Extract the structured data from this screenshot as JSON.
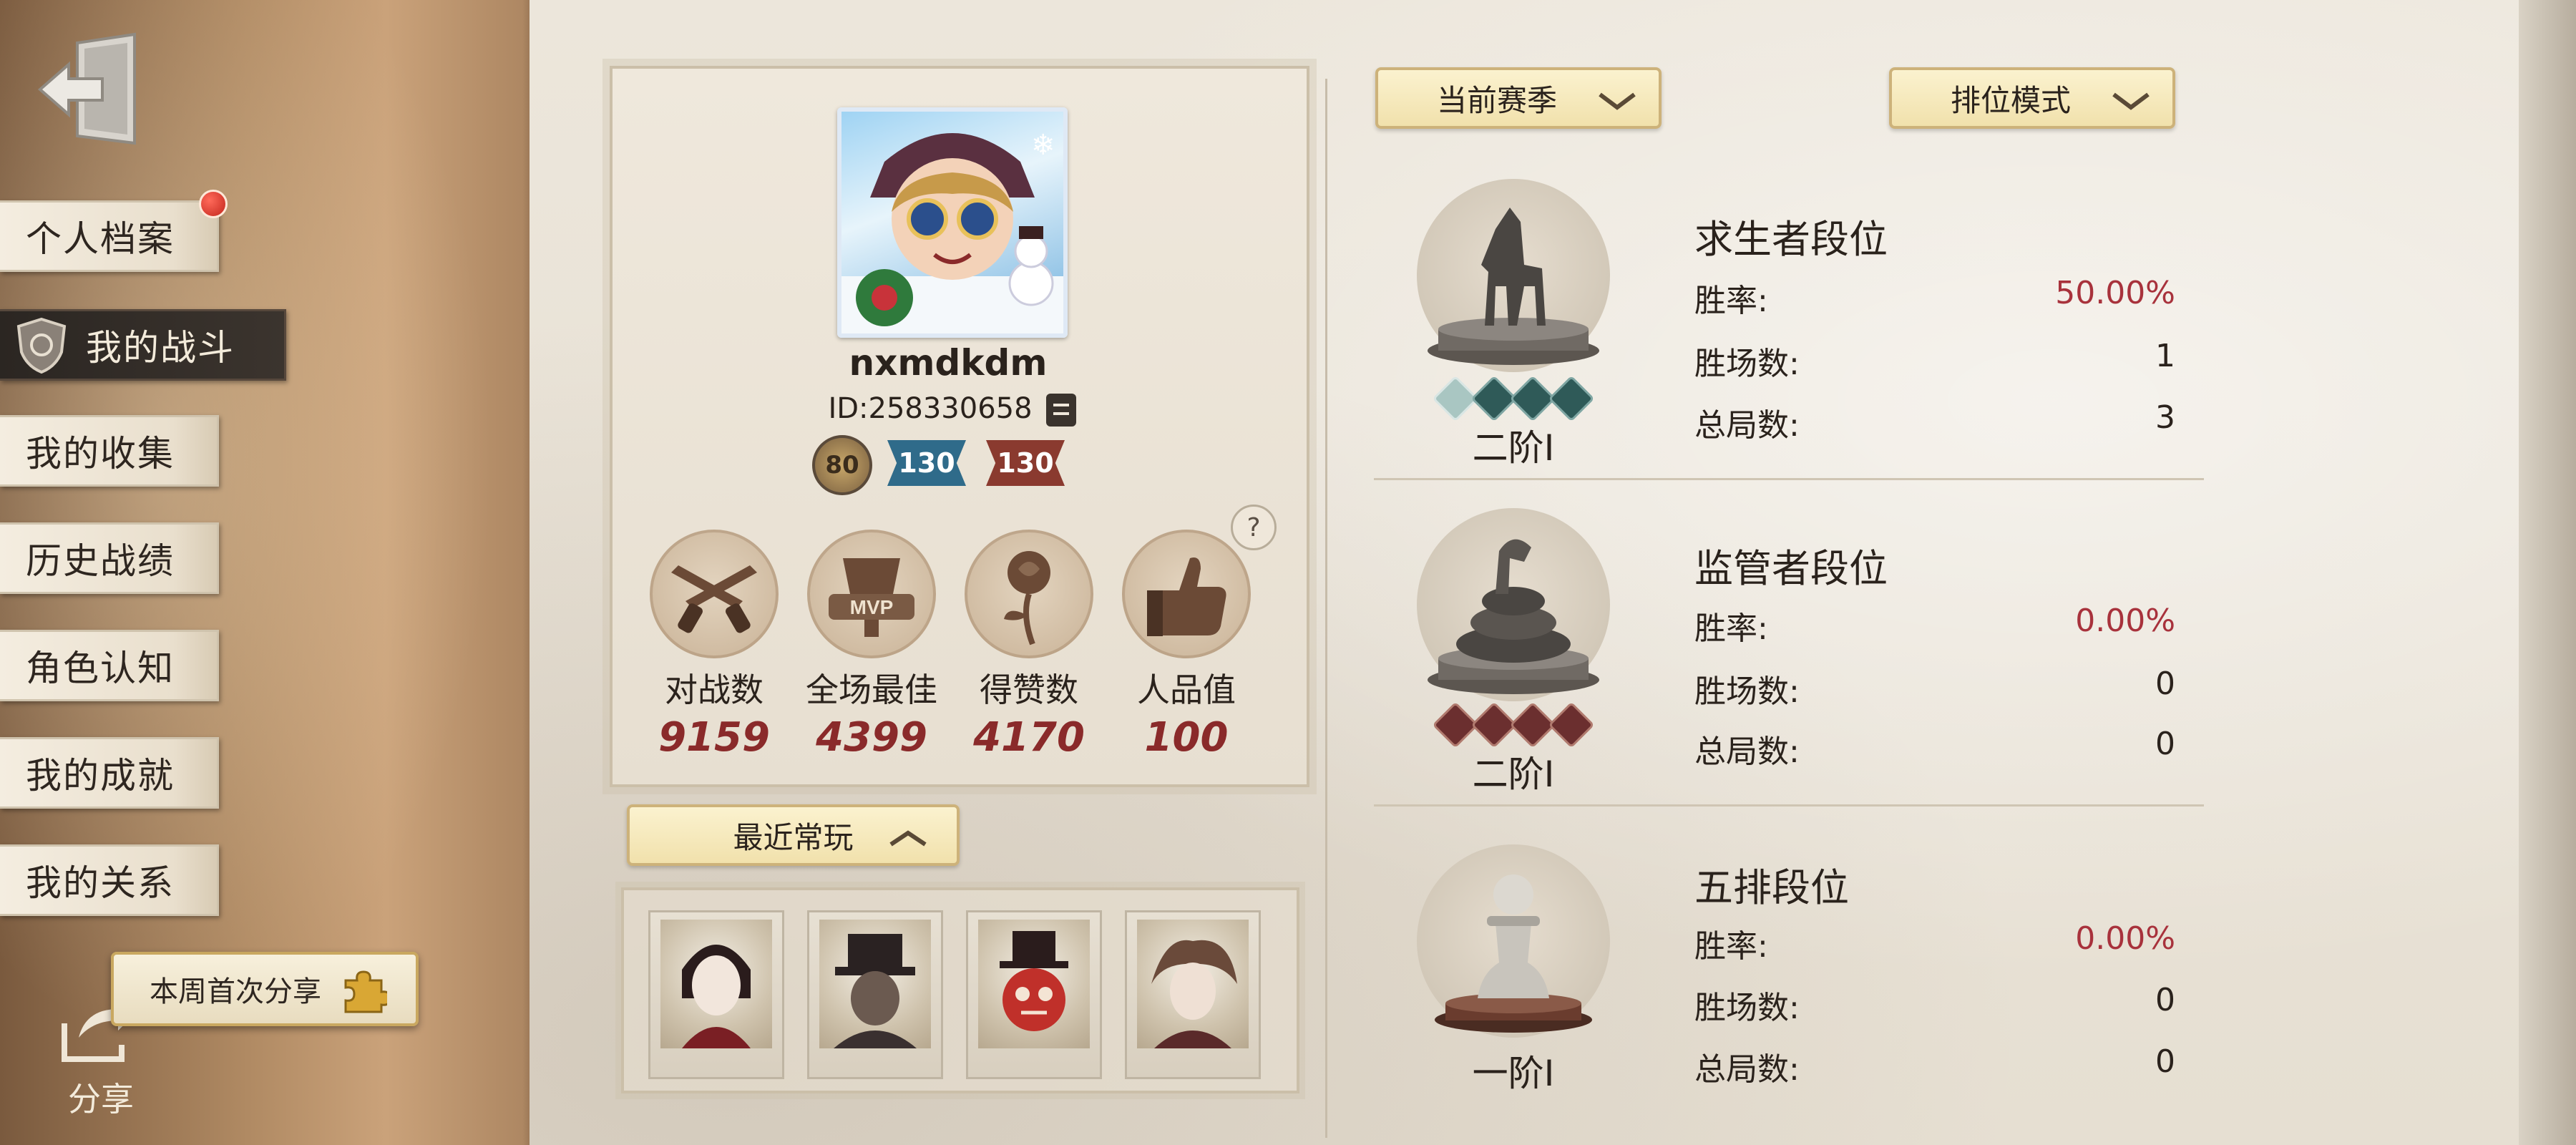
{
  "sidebar": {
    "menu": [
      {
        "label": "个人档案",
        "active": false,
        "badge": true
      },
      {
        "label": "我的战斗",
        "active": true,
        "badge": false
      },
      {
        "label": "我的收集",
        "active": false,
        "badge": false
      },
      {
        "label": "历史战绩",
        "active": false,
        "badge": false
      },
      {
        "label": "角色认知",
        "active": false,
        "badge": false
      },
      {
        "label": "我的成就",
        "active": false,
        "badge": false
      },
      {
        "label": "我的关系",
        "active": false,
        "badge": false
      }
    ],
    "share_tip": "本周首次分享",
    "share_label": "分享"
  },
  "profile": {
    "name": "nxmdkdm",
    "id": "ID:258330658",
    "level": "80",
    "rank_badge_survivor": "130",
    "rank_badge_hunter": "130",
    "stats": [
      {
        "icon": "crossed-guns-icon",
        "label": "对战数",
        "value": "9159"
      },
      {
        "icon": "mvp-trophy-icon",
        "label": "全场最佳",
        "value": "4399"
      },
      {
        "icon": "rose-icon",
        "label": "得赞数",
        "value": "4170"
      },
      {
        "icon": "thumbs-up-icon",
        "label": "人品值",
        "value": "100"
      }
    ]
  },
  "recent": {
    "label": "最近常玩",
    "characters": [
      "character-portrait-1",
      "character-portrait-2",
      "character-portrait-3",
      "character-portrait-4"
    ]
  },
  "filters": {
    "season": "当前赛季",
    "mode": "排位模式"
  },
  "ranks": [
    {
      "title": "求生者段位",
      "winrate_label": "胜率:",
      "winrate": "50.00%",
      "wins_label": "胜场数:",
      "wins": "1",
      "total_label": "总局数:",
      "total": "3",
      "tier": "二阶Ⅰ",
      "trophy": "horse-trophy-icon",
      "star_color": "#2f5a58",
      "star_first": "#a9c6c2"
    },
    {
      "title": "监管者段位",
      "winrate_label": "胜率:",
      "winrate": "0.00%",
      "wins_label": "胜场数:",
      "wins": "0",
      "total_label": "总局数:",
      "total": "0",
      "tier": "二阶Ⅰ",
      "trophy": "serpent-trophy-icon",
      "star_color": "#6b2f2f",
      "star_first": "#6b2f2f"
    },
    {
      "title": "五排段位",
      "winrate_label": "胜率:",
      "winrate": "0.00%",
      "wins_label": "胜场数:",
      "wins": "0",
      "total_label": "总局数:",
      "total": "0",
      "tier": "一阶Ⅰ",
      "trophy": "pawn-trophy-icon",
      "star_color": "",
      "star_first": ""
    }
  ],
  "colors": {
    "accent_red": "#a8323c",
    "gold": "#cdb27a"
  }
}
